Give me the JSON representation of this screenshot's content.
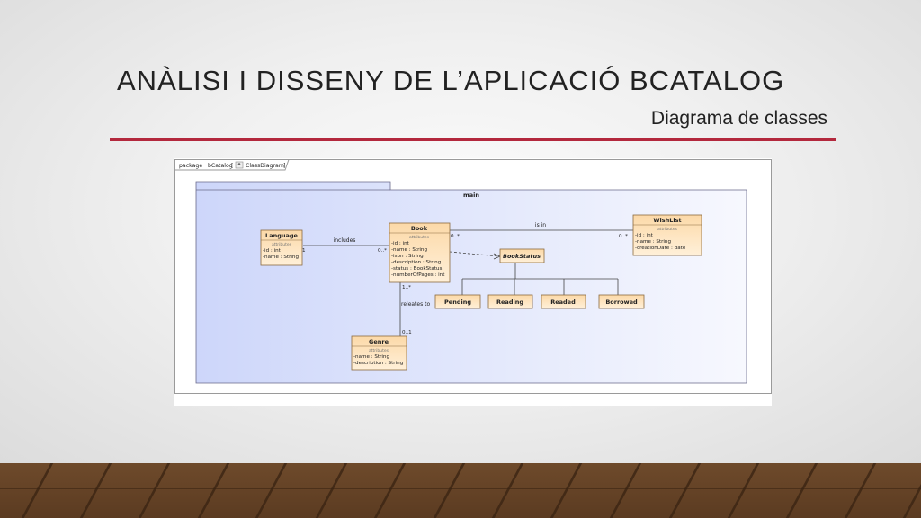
{
  "slide": {
    "title": "ANÀLISI I DISSENY DE L’APLICACIÓ BCATALOG",
    "subtitle": "Diagrama de classes",
    "accent_color": "#b3283d"
  },
  "diagram": {
    "package_tab": {
      "keyword": "package",
      "name": "bCatalog",
      "open_bracket": "[",
      "diagram_name": "ClassDiagram",
      "close_bracket": "]"
    },
    "frame_title": "main",
    "attributes_label": "attributes",
    "classes": {
      "language": {
        "name": "Language",
        "attributes": [
          "-id : int",
          "-name : String"
        ]
      },
      "book": {
        "name": "Book",
        "attributes": [
          "-id : int",
          "-name : String",
          "-isbn : String",
          "-description : String",
          "-status : BookStatus",
          "-numberOfPages : int"
        ]
      },
      "wishlist": {
        "name": "WishList",
        "attributes": [
          "-id : int",
          "-name : String",
          "-creationDate : date"
        ]
      },
      "genre": {
        "name": "Genre",
        "attributes": [
          "-name : String",
          "-description : String"
        ]
      },
      "bookstatus": {
        "name": "BookStatus"
      },
      "pending": {
        "name": "Pending"
      },
      "reading": {
        "name": "Reading"
      },
      "readed": {
        "name": "Readed"
      },
      "borrowed": {
        "name": "Borrowed"
      }
    },
    "associations": {
      "includes": {
        "label": "includes",
        "mult_language": "1",
        "mult_book": "0..*"
      },
      "is_in": {
        "label": "is in",
        "mult_book": "0..*",
        "mult_wishlist": "0..*"
      },
      "releates_to": {
        "label": "releates to",
        "mult_book": "1..*",
        "mult_genre": "0..1"
      }
    },
    "colors": {
      "class_fill": "#fde0b6",
      "class_stroke": "#8b6a3e",
      "frame_fill": "#dfe5fb"
    }
  }
}
